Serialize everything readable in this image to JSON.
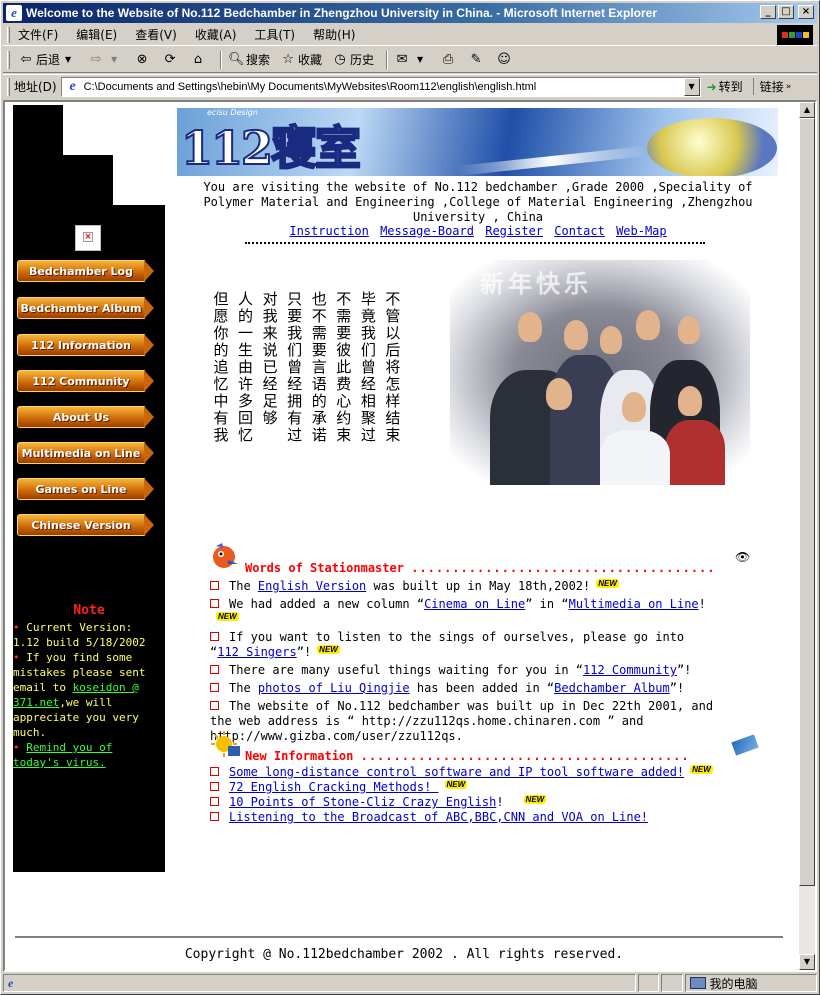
{
  "window": {
    "title": "Welcome to the Website of No.112 Bedchamber in Zhengzhou University in China. - Microsoft Internet Explorer",
    "controls": [
      "_",
      "□",
      "×"
    ]
  },
  "menubar": {
    "items": [
      "文件(F)",
      "编辑(E)",
      "查看(V)",
      "收藏(A)",
      "工具(T)",
      "帮助(H)"
    ]
  },
  "toolbar": {
    "back": "后退",
    "search": "搜索",
    "favorites": "收藏",
    "history": "历史"
  },
  "address": {
    "label": "地址(D)",
    "url": "C:\\Documents and Settings\\hebin\\My Documents\\MyWebsites\\Room112\\english\\english.html",
    "go": "转到",
    "links": "链接"
  },
  "page": {
    "banner": {
      "logo": "112寝室",
      "brand": "ecisu Design"
    },
    "visit_text": "You are visiting the website of No.112 bedchamber ,Grade 2000 ,Speciality of Polymer Material and Engineering ,College of Material Engineering ,Zhengzhou University , China",
    "top_links": [
      "Instruction",
      "Message-Board",
      "Register",
      "Contact",
      "Web-Map"
    ],
    "nav_buttons": [
      "Bedchamber Log",
      "Bedchamber Album",
      "112 Information",
      "112 Community",
      "About Us",
      "Multimedia on Line",
      "Games on Line",
      "Chinese Version"
    ],
    "note": {
      "title": "Note",
      "line1": "Current Version:",
      "line2": "1.12 build 5/18/2002",
      "line3": "If you find some mistakes please sent email to ",
      "email": "koseidon @ 371.net",
      "line4": ",we will appreciate you very much.",
      "remind": "Remind you of today's virus."
    },
    "poem_columns": [
      "不管以后将怎样结束",
      "毕竟我们曾经相聚过",
      "不需要彼此费心约束",
      "也不需要言语的承诺",
      "只要我们曾经拥有过",
      "对我来说已经足够",
      "人的一生由许多回忆",
      "但愿你的追忆中有我"
    ],
    "photo_caption": "新年快乐",
    "words": {
      "title": "Words of Stationmaster",
      "dots": ".....................................",
      "items": [
        {
          "pre": "The ",
          "link": "English Version",
          "post": " was built up in May 18th,2002!",
          "is_new": true
        },
        {
          "pre": "We had added a new column “",
          "link": "Cinema on Line",
          "mid": "” in “",
          "link2": "Multimedia on Line",
          "post": "!",
          "is_new": true
        },
        {
          "pre": "If you want to listen to the sings of ourselves, please go into “",
          "link": "112 Singers",
          "post": "”!",
          "is_new": true
        },
        {
          "pre": "There are many useful things waiting for you in “",
          "link": "112 Community",
          "post": "”!"
        },
        {
          "pre": "The ",
          "link": "photos of Liu Qingjie",
          "mid": " has been added in “",
          "link2": "Bedchamber Album",
          "post": "”!"
        },
        {
          "pre": "The website of No.112 bedchamber was built up in Dec 22th 2001, and the web address is “ http://zzu112qs.home.chinaren.com ” and http://www.gizba.com/user/zzu112qs."
        }
      ]
    },
    "new_info": {
      "title": "New Information",
      "dots": "........................................",
      "items": [
        {
          "link": "Some long-distance control software and IP tool software added!",
          "is_new": true
        },
        {
          "link": "72 English Cracking Methods! ",
          "is_new": true
        },
        {
          "link": "10 Points of Stone-Cliz Crazy English",
          "post": "!",
          "is_new": true
        },
        {
          "link": "Listening to the Broadcast of ABC,BBC,CNN and VOA on Line! "
        }
      ]
    },
    "new_tag": "NEW",
    "copyright": "Copyright @ No.112bedchamber 2002 . All rights reserved."
  },
  "statusbar": {
    "zone": "我的电脑"
  }
}
